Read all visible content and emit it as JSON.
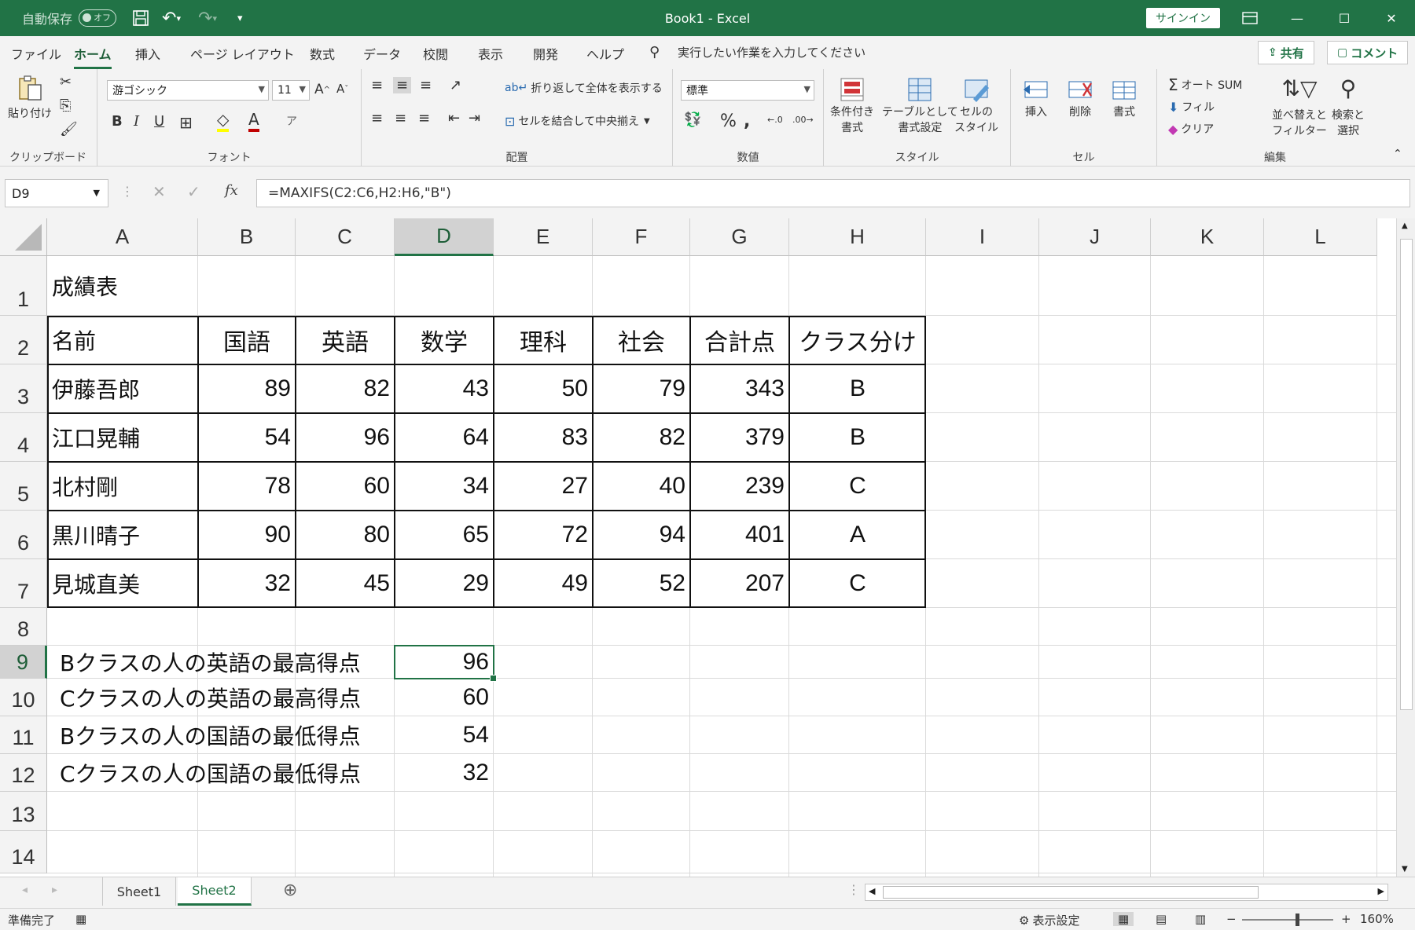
{
  "titlebar": {
    "autosave_label": "自動保存",
    "autosave_state": "オフ",
    "title": "Book1  -  Excel",
    "signin": "サインイン"
  },
  "tabs": [
    "ファイル",
    "ホーム",
    "挿入",
    "ページ レイアウト",
    "数式",
    "データ",
    "校閲",
    "表示",
    "開発",
    "ヘルプ"
  ],
  "active_tab": "ホーム",
  "tell_me": "実行したい作業を入力してください",
  "share": "共有",
  "comment": "コメント",
  "ribbon": {
    "clipboard": {
      "paste": "貼り付け",
      "label": "クリップボード"
    },
    "font": {
      "name": "游ゴシック",
      "size": "11",
      "label": "フォント"
    },
    "alignment": {
      "wrap": "折り返して全体を表示する",
      "merge": "セルを結合して中央揃え",
      "label": "配置"
    },
    "number": {
      "format": "標準",
      "label": "数値"
    },
    "styles": {
      "conditional": [
        "条件付き",
        "書式"
      ],
      "table": [
        "テーブルとして",
        "書式設定"
      ],
      "cell": [
        "セルの",
        "スタイル"
      ],
      "label": "スタイル"
    },
    "cells": {
      "insert": "挿入",
      "delete": "削除",
      "format": "書式",
      "label": "セル"
    },
    "editing": {
      "autosum": "オート SUM",
      "fill": "フィル",
      "clear": "クリア",
      "sort": [
        "並べ替えと",
        "フィルター"
      ],
      "find": [
        "検索と",
        "選択"
      ],
      "label": "編集"
    }
  },
  "formula_bar": {
    "name_box": "D9",
    "formula": "=MAXIFS(C2:C6,H2:H6,\"B\")"
  },
  "columns": [
    "A",
    "B",
    "C",
    "D",
    "E",
    "F",
    "G",
    "H",
    "I",
    "J",
    "K",
    "L"
  ],
  "rows": [
    "1",
    "2",
    "3",
    "4",
    "5",
    "6",
    "7",
    "8",
    "9",
    "10",
    "11",
    "12",
    "13",
    "14"
  ],
  "sheet": {
    "title": "成績表",
    "headers": [
      "名前",
      "国語",
      "英語",
      "数学",
      "理科",
      "社会",
      "合計点",
      "クラス分け"
    ],
    "records": [
      [
        "伊藤吾郎",
        "89",
        "82",
        "43",
        "50",
        "79",
        "343",
        "B"
      ],
      [
        "江口晃輔",
        "54",
        "96",
        "64",
        "83",
        "82",
        "379",
        "B"
      ],
      [
        "北村剛",
        "78",
        "60",
        "34",
        "27",
        "40",
        "239",
        "C"
      ],
      [
        "黒川晴子",
        "90",
        "80",
        "65",
        "72",
        "94",
        "401",
        "A"
      ],
      [
        "見城直美",
        "32",
        "45",
        "29",
        "49",
        "52",
        "207",
        "C"
      ]
    ],
    "summary": [
      {
        "label": "Bクラスの人の英語の最高得点",
        "value": "96"
      },
      {
        "label": "Cクラスの人の英語の最高得点",
        "value": "60"
      },
      {
        "label": "Bクラスの人の国語の最低得点",
        "value": "54"
      },
      {
        "label": "Cクラスの人の国語の最低得点",
        "value": "32"
      }
    ]
  },
  "sheet_tabs": [
    "Sheet1",
    "Sheet2"
  ],
  "active_sheet": "Sheet2",
  "status": {
    "ready": "準備完了",
    "display_settings": "表示設定",
    "zoom": "160%"
  }
}
